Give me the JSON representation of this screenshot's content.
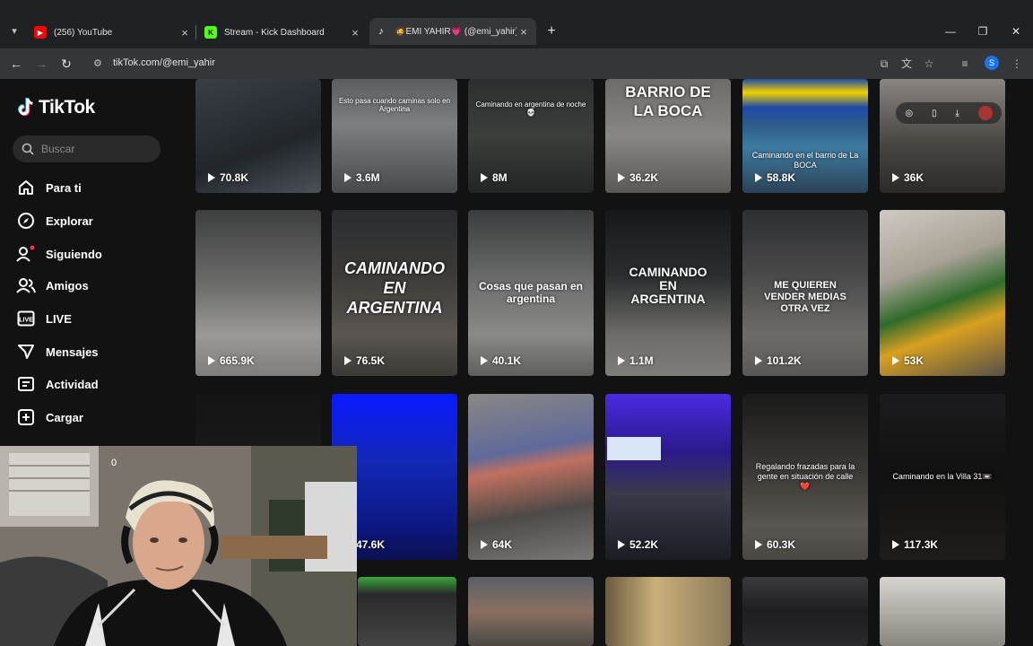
{
  "browser": {
    "tabs": [
      {
        "title": "(256) YouTube",
        "favicon": "youtube-icon",
        "color": "#ff0000",
        "active": false
      },
      {
        "title": "Stream - Kick Dashboard",
        "favicon": "kick-icon",
        "color": "#53fc18",
        "active": false
      },
      {
        "title": "🧔EMI YAHIR💗 (@emi_yahir)",
        "favicon": "tiktok-icon",
        "color": "#ffffff",
        "active": true
      }
    ],
    "url": "tikTok.com/@emi_yahir",
    "profile_initial": "S"
  },
  "tiktok": {
    "brand": "TikTok",
    "search_placeholder": "Buscar",
    "nav": [
      {
        "label": "Para ti",
        "icon": "home-icon"
      },
      {
        "label": "Explorar",
        "icon": "compass-icon"
      },
      {
        "label": "Siguiendo",
        "icon": "following-icon"
      },
      {
        "label": "Amigos",
        "icon": "friends-icon"
      },
      {
        "label": "LIVE",
        "icon": "live-icon"
      },
      {
        "label": "Mensajes",
        "icon": "messages-icon"
      },
      {
        "label": "Actividad",
        "icon": "activity-icon"
      },
      {
        "label": "Cargar",
        "icon": "upload-icon"
      }
    ],
    "rows": [
      [
        {
          "views": "70.8K",
          "caption": ""
        },
        {
          "views": "3.6M",
          "caption": "Esto pasa cuando caminas solo en Argentina"
        },
        {
          "views": "8M",
          "caption": "Caminando en argentina de noche💀"
        },
        {
          "views": "36.2K",
          "caption": "BARRIO DE LA BOCA"
        },
        {
          "views": "58.8K",
          "caption": "Caminando en el barrio de La BOCA"
        },
        {
          "views": "36K",
          "caption": ""
        }
      ],
      [
        {
          "views": "665.9K",
          "caption": ""
        },
        {
          "views": "76.5K",
          "caption": "CAMINANDO EN ARGENTINA"
        },
        {
          "views": "40.1K",
          "caption": "Cosas que pasan en argentina"
        },
        {
          "views": "1.1M",
          "caption": "CAMINANDO EN ARGENTINA"
        },
        {
          "views": "101.2K",
          "caption": "ME QUIEREN VENDER MEDIAS OTRA VEZ"
        },
        {
          "views": "53K",
          "caption": ""
        }
      ],
      [
        {
          "views": "",
          "caption": ""
        },
        {
          "views": "47.6K",
          "caption": ""
        },
        {
          "views": "64K",
          "caption": ""
        },
        {
          "views": "52.2K",
          "caption": ""
        },
        {
          "views": "60.3K",
          "caption": "Regalando frazadas para la gente en situación de calle❤️"
        },
        {
          "views": "117.3K",
          "caption": "Caminando en la Villa 31📼"
        }
      ]
    ]
  },
  "webcam": {
    "counter": "0"
  }
}
